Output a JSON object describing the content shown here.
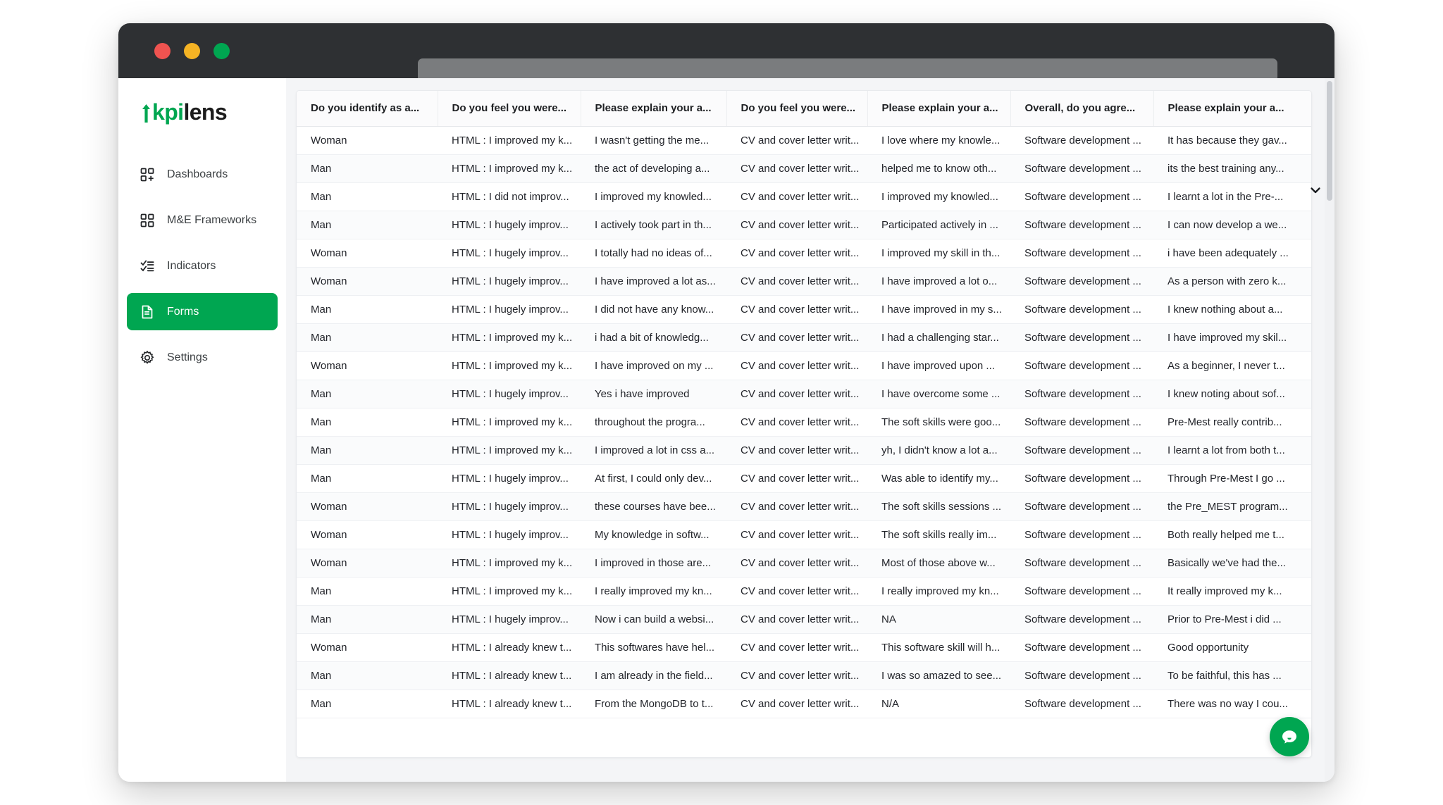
{
  "window": {
    "traffic_lights": [
      "close",
      "minimize",
      "zoom"
    ],
    "url_value": "",
    "url_placeholder": ""
  },
  "sidebar": {
    "logo": {
      "part1": "kpi",
      "part2": "lens"
    },
    "items": [
      {
        "label": "Dashboards",
        "icon": "grid-plus-icon",
        "active": false
      },
      {
        "label": "M&E Frameworks",
        "icon": "grid-icon",
        "active": false
      },
      {
        "label": "Indicators",
        "icon": "checklist-icon",
        "active": false
      },
      {
        "label": "Forms",
        "icon": "document-icon",
        "active": true
      },
      {
        "label": "Settings",
        "icon": "gear-icon",
        "active": false
      }
    ]
  },
  "table": {
    "columns": [
      "Do you identify as a...",
      "Do you feel you were...",
      "Please explain your a...",
      "Do you feel you were...",
      "Please explain your a...",
      "Overall, do you agre...",
      "Please explain your a..."
    ],
    "rows": [
      [
        "Woman",
        "HTML : I improved my k...",
        "I wasn't getting the me...",
        "CV and cover letter writ...",
        "I love where my knowle...",
        "Software development ...",
        "It has because they gav..."
      ],
      [
        "Man",
        "HTML : I improved my k...",
        "the act of developing a...",
        "CV and cover letter writ...",
        "helped me to know oth...",
        "Software development ...",
        "its the best training any..."
      ],
      [
        "Man",
        "HTML : I did not improv...",
        "I improved my knowled...",
        "CV and cover letter writ...",
        "I improved my knowled...",
        "Software development ...",
        "I learnt a lot in the Pre-..."
      ],
      [
        "Man",
        "HTML : I hugely improv...",
        "I actively took part in th...",
        "CV and cover letter writ...",
        "Participated actively in ...",
        "Software development ...",
        "I can now develop a we..."
      ],
      [
        "Woman",
        "HTML : I hugely improv...",
        "I totally had no ideas of...",
        "CV and cover letter writ...",
        "I improved my skill in th...",
        "Software development ...",
        "i have been adequately ..."
      ],
      [
        "Woman",
        "HTML : I hugely improv...",
        "I have improved a lot as...",
        "CV and cover letter writ...",
        "I have improved a lot o...",
        "Software development ...",
        "As a person with zero k..."
      ],
      [
        "Man",
        "HTML : I hugely improv...",
        "I did not have any know...",
        "CV and cover letter writ...",
        "I have improved in my s...",
        "Software development ...",
        "I knew nothing about a..."
      ],
      [
        "Man",
        "HTML : I improved my k...",
        "i had a bit of knowledg...",
        "CV and cover letter writ...",
        "I had a challenging star...",
        "Software development ...",
        "I have improved my skil..."
      ],
      [
        "Woman",
        "HTML : I improved my k...",
        "I have improved on my ...",
        "CV and cover letter writ...",
        "I have improved upon ...",
        "Software development ...",
        "As a beginner, I never t..."
      ],
      [
        "Man",
        "HTML : I hugely improv...",
        "Yes i have improved",
        "CV and cover letter writ...",
        "I have overcome some ...",
        "Software development ...",
        "I knew noting about sof..."
      ],
      [
        "Man",
        "HTML : I improved my k...",
        "throughout the progra...",
        "CV and cover letter writ...",
        "The soft skills were goo...",
        "Software development ...",
        "Pre-Mest really contrib..."
      ],
      [
        "Man",
        "HTML : I improved my k...",
        "I improved a lot in css a...",
        "CV and cover letter writ...",
        "yh, I didn't know a lot a...",
        "Software development ...",
        "I learnt a lot from both t..."
      ],
      [
        "Man",
        "HTML : I hugely improv...",
        "At first, I could only dev...",
        "CV and cover letter writ...",
        "Was able to identify my...",
        "Software development ...",
        "Through Pre-Mest I go ..."
      ],
      [
        "Woman",
        "HTML : I hugely improv...",
        "these courses have bee...",
        "CV and cover letter writ...",
        "The soft skills sessions ...",
        "Software development ...",
        "the Pre_MEST program..."
      ],
      [
        "Woman",
        "HTML : I hugely improv...",
        "My knowledge in softw...",
        "CV and cover letter writ...",
        "The soft skills really im...",
        "Software development ...",
        "Both really helped me t..."
      ],
      [
        "Woman",
        "HTML : I improved my k...",
        "I improved in those are...",
        "CV and cover letter writ...",
        "Most of those above w...",
        "Software development ...",
        "Basically we've had the..."
      ],
      [
        "Man",
        "HTML : I improved my k...",
        "I really improved my kn...",
        "CV and cover letter writ...",
        "I really improved my kn...",
        "Software development ...",
        "It really improved my k..."
      ],
      [
        "Man",
        "HTML : I hugely improv...",
        "Now i can build a websi...",
        "CV and cover letter writ...",
        "NA",
        "Software development ...",
        "Prior to Pre-Mest i did ..."
      ],
      [
        "Woman",
        "HTML : I already knew t...",
        "This softwares have hel...",
        "CV and cover letter writ...",
        "This software skill will h...",
        "Software development ...",
        "Good opportunity"
      ],
      [
        "Man",
        "HTML : I already knew t...",
        "I am already in the field...",
        "CV and cover letter writ...",
        "I was so amazed to see...",
        "Software development ...",
        "To be faithful, this has ..."
      ],
      [
        "Man",
        "HTML : I already knew t...",
        "From the MongoDB to t...",
        "CV and cover letter writ...",
        "N/A",
        "Software development ...",
        "There was no way I cou..."
      ]
    ]
  },
  "widgets": {
    "chat_icon": "chat-bubble-icon",
    "header_chevron_icon": "chevron-down-icon"
  },
  "colors": {
    "brand_green": "#00a651",
    "titlebar": "#2e3033",
    "page_bg": "#f4f5f7"
  }
}
